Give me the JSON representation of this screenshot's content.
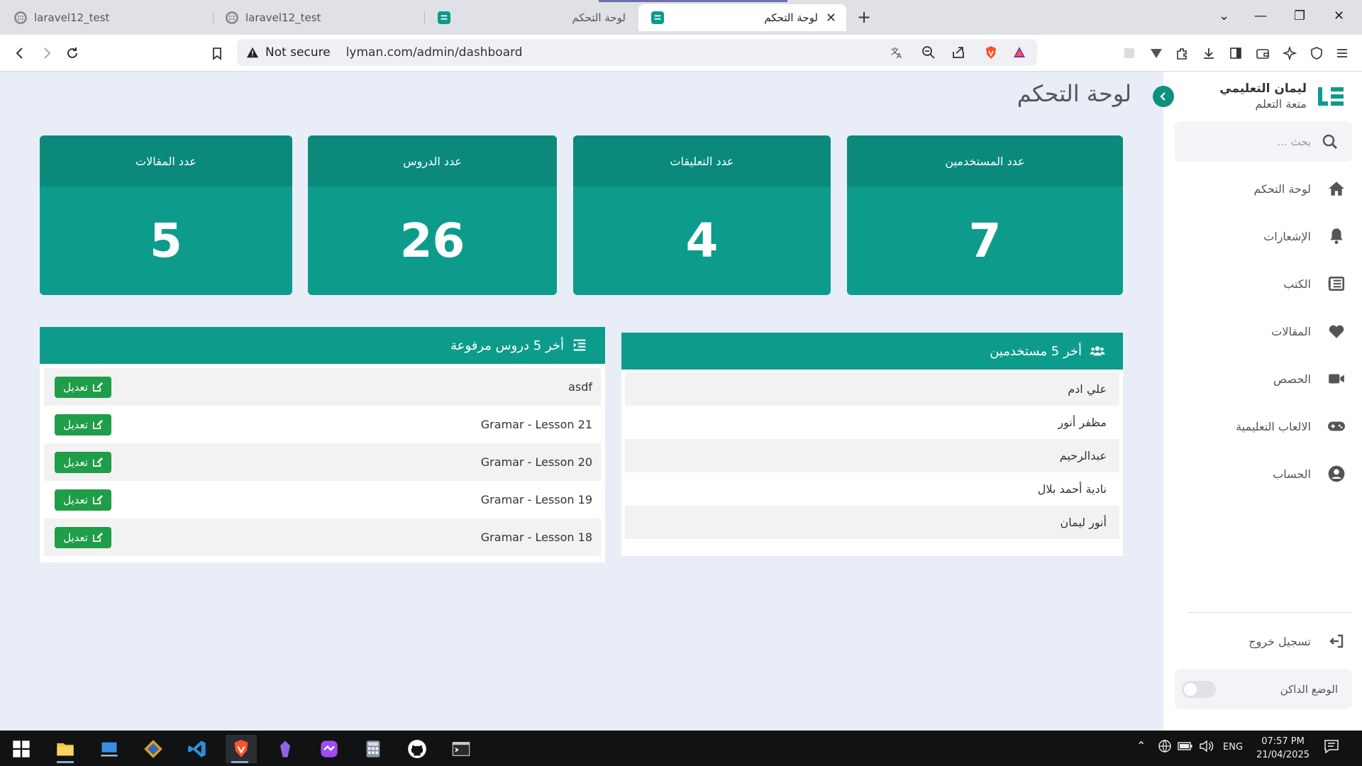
{
  "browser": {
    "tabs": [
      {
        "title": "laravel12_test",
        "favicon": "globe-icon",
        "active": false
      },
      {
        "title": "laravel12_test",
        "favicon": "globe-icon",
        "active": false
      },
      {
        "title": "لوحة التحكم",
        "favicon": "app-icon",
        "active": false
      },
      {
        "title": "لوحة التحكم",
        "favicon": "app-icon",
        "active": true
      }
    ],
    "security_label": "Not secure",
    "url": "lyman.com/admin/dashboard"
  },
  "sidebar": {
    "brand_title": "ليمان التعليمي",
    "brand_subtitle": "متعة التعلم",
    "search_placeholder": "بحث ...",
    "items": [
      {
        "label": "لوحة التحكم",
        "icon": "home-icon"
      },
      {
        "label": "الإشعارات",
        "icon": "bell-icon"
      },
      {
        "label": "الكتب",
        "icon": "book-icon"
      },
      {
        "label": "المقالات",
        "icon": "heart-icon"
      },
      {
        "label": "الحصص",
        "icon": "video-icon"
      },
      {
        "label": "الالعاب التعليمية",
        "icon": "gamepad-icon"
      },
      {
        "label": "الحساب",
        "icon": "user-circle-icon"
      }
    ],
    "logout_label": "تسجيل خروج",
    "dark_mode_label": "الوضع الداكن",
    "dark_mode_on": false
  },
  "main": {
    "title": "لوحة التحكم",
    "stats": [
      {
        "label": "عدد المستخدمين",
        "value": "7"
      },
      {
        "label": "عدد التعليقات",
        "value": "4"
      },
      {
        "label": "عدد الدروس",
        "value": "26"
      },
      {
        "label": "عدد المقالات",
        "value": "5"
      }
    ],
    "users_panel": {
      "title": "أخر 5 مستخدمين",
      "users": [
        "علي ادم",
        "مظفر أنور",
        "عبدالرحيم",
        "نادية أحمد بلال",
        "أنور ليمان"
      ]
    },
    "lessons_panel": {
      "title": "أخر 5 دروس مرفوعة",
      "edit_label": "تعديل",
      "lessons": [
        "asdf",
        "Gramar - Lesson 21",
        "Gramar - Lesson 20",
        "Gramar - Lesson 19",
        "Gramar - Lesson 18"
      ]
    }
  },
  "taskbar": {
    "language": "ENG",
    "time": "07:57 PM",
    "date": "21/04/2025"
  },
  "colors": {
    "accent": "#0d9c8c",
    "accent_dark": "#0b8a7c",
    "edit_button": "#1f9d48",
    "page_bg": "#e9edf7"
  }
}
